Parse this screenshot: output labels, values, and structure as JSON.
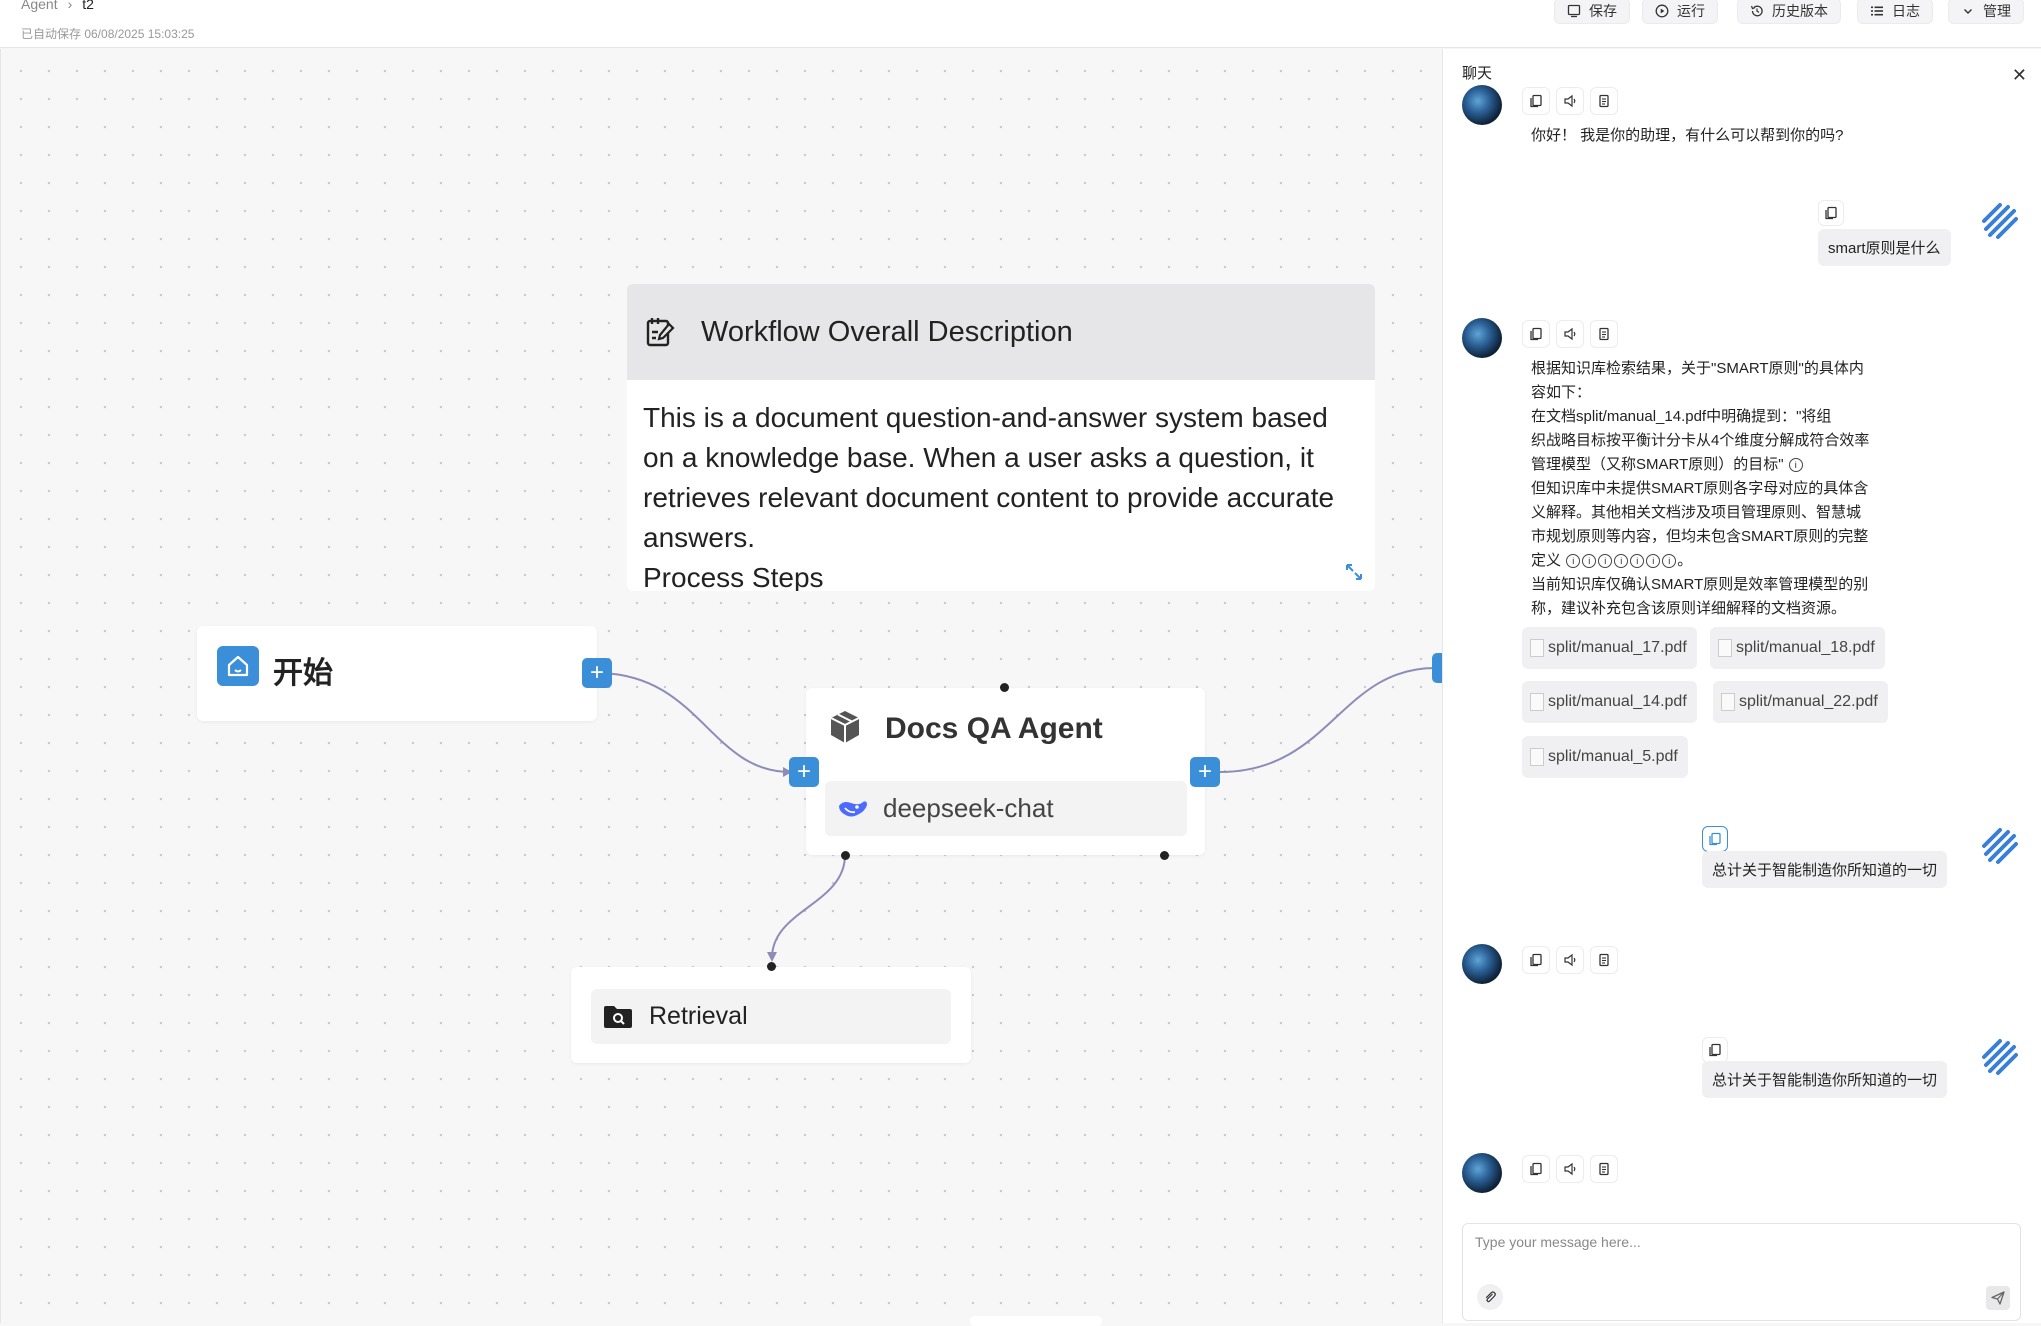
{
  "header": {
    "breadcrumb_root": "Agent",
    "breadcrumb_current": "t2",
    "autosave": "已自动保存 06/08/2025 15:03:25",
    "buttons": {
      "save": "保存",
      "run": "运行",
      "history": "历史版本",
      "log": "日志",
      "manage": "管理"
    }
  },
  "canvas": {
    "note": {
      "title": "Workflow Overall Description",
      "body": "This is a document question-and-answer system based on a knowledge base. When a user asks a question, it retrieves relevant document content to provide accurate answers.\nProcess Steps"
    },
    "start_node": {
      "label": "开始",
      "icon": "home-icon"
    },
    "agent_node": {
      "label": "Docs QA Agent",
      "model": "deepseek-chat",
      "icon": "cube-icon"
    },
    "retrieval_node": {
      "label": "Retrieval",
      "icon": "folder-search-icon"
    },
    "accent_color": "#3b8ed8",
    "edge_color": "#8f8bb8"
  },
  "chat": {
    "title": "聊天",
    "messages": [
      {
        "role": "assistant",
        "text": "你好！ 我是你的助理，有什么可以帮到你的吗?"
      },
      {
        "role": "user",
        "text": "smart原则是什么"
      },
      {
        "role": "assistant",
        "lines": [
          "根据知识库检索结果，关于\"SMART原则\"的具体内",
          "容如下：",
          "在文档split/manual_14.pdf中明确提到：\"将组",
          "织战略目标按平衡计分卡从4个维度分解成符合效率",
          "管理模型（又称SMART原则）的目标\"",
          "但知识库中未提供SMART原则各字母对应的具体含",
          "义解释。其他相关文档涉及项目管理原则、智慧城",
          "市规划原则等内容，但均未包含SMART原则的完整",
          "定义",
          "当前知识库仅确认SMART原则是效率管理模型的别",
          "称，建议补充包含该原则详细解释的文档资源。"
        ],
        "sources": [
          "split/manual_17.pdf",
          "split/manual_18.pdf",
          "split/manual_14.pdf",
          "split/manual_22.pdf",
          "split/manual_5.pdf"
        ]
      },
      {
        "role": "user",
        "text": "总计关于智能制造你所知道的一切"
      },
      {
        "role": "assistant",
        "text": ""
      },
      {
        "role": "user",
        "text": "总计关于智能制造你所知道的一切"
      },
      {
        "role": "assistant",
        "text": ""
      }
    ],
    "input_placeholder": "Type your message here..."
  }
}
